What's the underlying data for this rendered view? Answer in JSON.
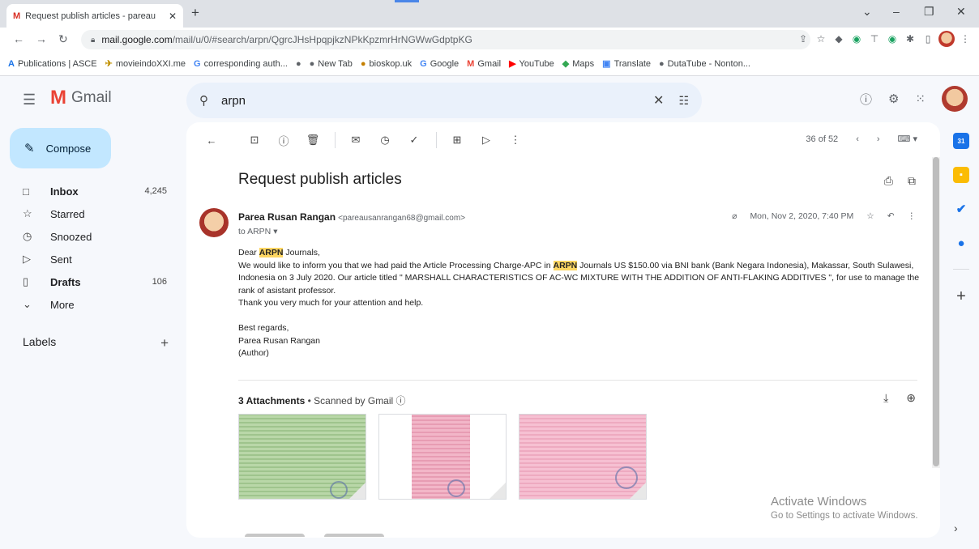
{
  "browser": {
    "tab_title": "Request publish articles - pareau",
    "tab_favicon": "M",
    "url_host": "mail.google.com",
    "url_path": "/mail/u/0/#search/arpn/QgrcJHsHpqpjkzNPkKpzmrHrNGWwGdptpKG",
    "bookmarks": [
      {
        "icon": "A",
        "label": "Publications | ASCE"
      },
      {
        "icon": "✈",
        "label": "movieindoXXI.me"
      },
      {
        "icon": "G",
        "label": "corresponding auth..."
      },
      {
        "icon": "●",
        "label": ""
      },
      {
        "icon": "●",
        "label": "New Tab"
      },
      {
        "icon": "●",
        "label": "bioskop.uk"
      },
      {
        "icon": "G",
        "label": "Google"
      },
      {
        "icon": "M",
        "label": "Gmail"
      },
      {
        "icon": "▶",
        "label": "YouTube"
      },
      {
        "icon": "◆",
        "label": "Maps"
      },
      {
        "icon": "▣",
        "label": "Translate"
      },
      {
        "icon": "●",
        "label": "DutaTube - Nonton..."
      }
    ]
  },
  "gmail": {
    "logo_text": "Gmail",
    "search_value": "arpn",
    "compose_label": "Compose",
    "nav": [
      {
        "icon": "□",
        "label": "Inbox",
        "count": "4,245",
        "bold": true
      },
      {
        "icon": "☆",
        "label": "Starred",
        "count": ""
      },
      {
        "icon": "◷",
        "label": "Snoozed",
        "count": ""
      },
      {
        "icon": "▷",
        "label": "Sent",
        "count": ""
      },
      {
        "icon": "▯",
        "label": "Drafts",
        "count": "106",
        "bold": true
      },
      {
        "icon": "⌵",
        "label": "More",
        "count": ""
      }
    ],
    "labels_heading": "Labels",
    "pager_text": "36 of 52"
  },
  "email": {
    "subject": "Request publish articles",
    "sender_name": "Parea Rusan Rangan",
    "sender_email": "<pareausanrangan68@gmail.com>",
    "to_line": "to ARPN",
    "date": "Mon, Nov 2, 2020, 7:40 PM",
    "greeting_pre": "Dear ",
    "greeting_hl": "ARPN",
    "greeting_post": " Journals,",
    "p1_pre": "We would like to inform you that  we had paid the Article Processing Charge-APC in ",
    "p1_hl": "ARPN",
    "p1_post": " Journals US $150.00 via BNI bank (Bank Negara Indonesia), Makassar, South Sulawesi, Indonesia on 3 July 2020. Our article titled \" MARSHALL CHARACTERISTICS OF AC-WC MIXTURE WITH THE ADDITION OF ANTI-FLAKING ADDITIVES \", for use to manage the rank of asistant professor.",
    "p2": "Thank you very much for your attention and help.",
    "closing": "Best regards,",
    "signature_name": "Parea Rusan Rangan",
    "signature_role": "(Author)",
    "attachments_title": "3 Attachments",
    "attachments_scanned": "Scanned by Gmail"
  },
  "watermark": {
    "line1": "Activate Windows",
    "line2": "Go to Settings to activate Windows."
  },
  "colors": {
    "highlight": "#fdd663",
    "compose_bg": "#c2e7ff",
    "search_bg": "#eaf1fb"
  }
}
